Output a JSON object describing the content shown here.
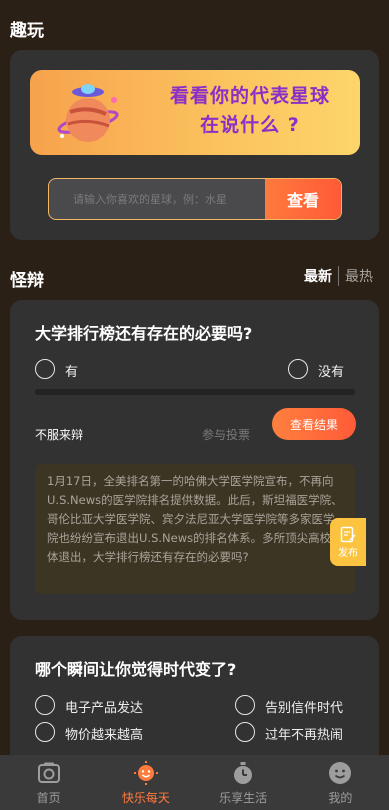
{
  "fun_section": {
    "title": "趣玩",
    "banner_line1": "看看你的代表星球",
    "banner_line2": "在说什么 ?",
    "search_placeholder": "请输入你喜欢的星球，例：水星",
    "search_button": "查看"
  },
  "debate_section": {
    "title": "怪辩",
    "sort_tabs": [
      "最新",
      "最热"
    ],
    "active_sort": "最新"
  },
  "debate_card_1": {
    "question": "大学排行榜还有存在的必要吗?",
    "option_yes": "有",
    "option_no": "没有",
    "vote_share_yes": 0,
    "dissent_label": "不服来辩",
    "join_vote": "参与投票",
    "result_button": "查看结果",
    "comment": "1月17日，全美排名第一的哈佛大学医学院宣布，不再向U.S.News的医学院排名提供数据。此后，斯坦福医学院、哥伦比亚大学医学院、宾夕法尼亚大学医学院等多家医学院也纷纷宣布退出U.S.News的排名体系。多所顶尖高校集体退出，大学排行榜还有存在的必要吗?"
  },
  "publish_button": "发布",
  "debate_card_2": {
    "question": "哪个瞬间让你觉得时代变了?",
    "options": [
      "电子产品发达",
      "告别信件时代",
      "物价越来越高",
      "过年不再热闹"
    ]
  },
  "tabbar": {
    "items": [
      {
        "label": "首页",
        "icon": "camera-icon"
      },
      {
        "label": "快乐每天",
        "icon": "smile-sun-icon"
      },
      {
        "label": "乐享生活",
        "icon": "stopwatch-icon"
      },
      {
        "label": "我的",
        "icon": "face-icon"
      }
    ],
    "active": "快乐每天"
  },
  "colors": {
    "accent": "#ff6a3a",
    "background": "#2a2016",
    "card": "#333233",
    "banner_text": "#8a2fc8",
    "publish": "#fbc33f"
  }
}
